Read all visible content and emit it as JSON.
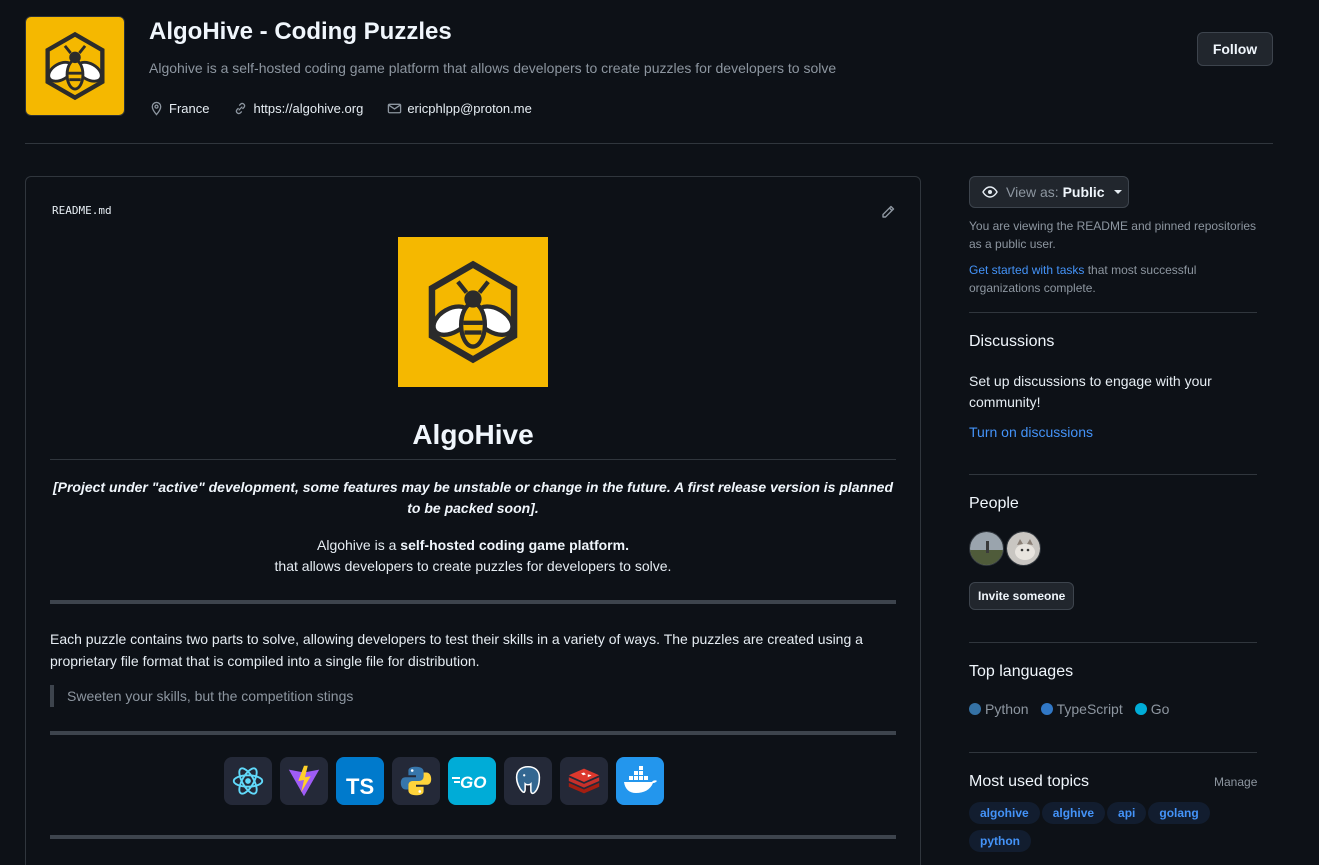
{
  "header": {
    "org_name": "AlgoHive - Coding Puzzles",
    "description": "Algohive is a self-hosted coding game platform that allows developers to create puzzles for developers to solve",
    "location": "France",
    "website": "https://algohive.org",
    "email": "ericphlpp@proton.me",
    "follow_label": "Follow"
  },
  "readme": {
    "filename": "README.md",
    "title": "AlgoHive",
    "notice": "[Project under \"active\" development, some features may be unstable or change in the future. A first release version is planned to be packed soon].",
    "intro_prefix": "Algohive is a ",
    "intro_bold": "self-hosted coding game platform.",
    "intro_line2": "that allows developers to create puzzles for developers to solve.",
    "paragraph": "Each puzzle contains two parts to solve, allowing developers to test their skills in a variety of ways. The puzzles are created using a proprietary file format that is compiled into a single file for distribution.",
    "quote": "Sweeten your skills, but the competition stings",
    "tech_icons": [
      "react-icon",
      "vite-icon",
      "typescript-icon",
      "python-icon",
      "go-icon",
      "postgresql-icon",
      "redis-icon",
      "docker-icon"
    ]
  },
  "sidebar": {
    "view_as_prefix": "View as:",
    "view_as_value": "Public",
    "view_as_note": "You are viewing the README and pinned repositories as a public user.",
    "get_started_link": "Get started with tasks",
    "get_started_rest": " that most successful organizations complete.",
    "discussions_heading": "Discussions",
    "discussions_text": "Set up discussions to engage with your community!",
    "discussions_link": "Turn on discussions",
    "people_heading": "People",
    "invite_label": "Invite someone",
    "languages_heading": "Top languages",
    "languages": [
      {
        "name": "Python",
        "color": "#3572A5"
      },
      {
        "name": "TypeScript",
        "color": "#3178c6"
      },
      {
        "name": "Go",
        "color": "#00ADD8"
      }
    ],
    "topics_heading": "Most used topics",
    "manage_label": "Manage",
    "topics": [
      "algohive",
      "alghive",
      "api",
      "golang",
      "python"
    ]
  },
  "colors": {
    "background": "#0d1117",
    "brand_yellow": "#f5b800",
    "link": "#4493f8"
  }
}
